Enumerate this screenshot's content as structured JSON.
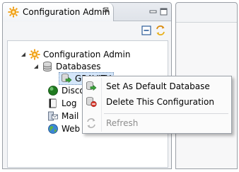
{
  "view": {
    "tab_title": "Configuration Admin",
    "tab_close_glyph": "⊠"
  },
  "tree": {
    "root": {
      "label": "Configuration Admin",
      "icon": "gear-sun-icon"
    },
    "databases": {
      "label": "Databases",
      "icon": "database-stack-icon"
    },
    "selected_db": {
      "label": "GRAVITY",
      "icon": "database-arrow-icon"
    },
    "children": [
      {
        "label": "Discovery",
        "icon": "green-circle-icon"
      },
      {
        "label": "Log",
        "icon": "log-book-icon"
      },
      {
        "label": "Mail S",
        "icon": "mail-server-icon"
      },
      {
        "label": "Web",
        "icon": "globe-icon"
      }
    ]
  },
  "context_menu": {
    "items": [
      {
        "label": "Set As Default Database",
        "icon": "set-default-db-icon",
        "enabled": true
      },
      {
        "label": "Delete This Configuration",
        "icon": "delete-config-icon",
        "enabled": true
      },
      {
        "label": "Refresh",
        "icon": "refresh-icon",
        "enabled": false
      }
    ]
  },
  "colors": {
    "selection": "#d4e6fa",
    "panel_border": "#9a9fa6",
    "gear_orange": "#f1a21c",
    "disabled_text": "#8d8d8d"
  }
}
